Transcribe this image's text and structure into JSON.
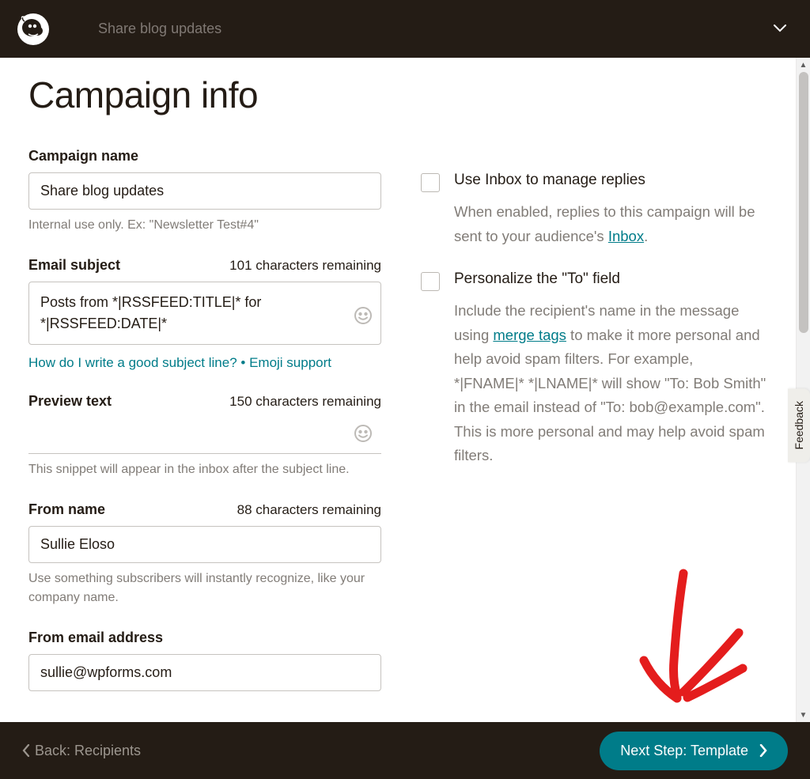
{
  "topbar": {
    "title": "Share blog updates"
  },
  "page": {
    "title": "Campaign info"
  },
  "fields": {
    "campaign_name": {
      "label": "Campaign name",
      "value": "Share blog updates",
      "hint": "Internal use only. Ex: \"Newsletter Test#4\""
    },
    "email_subject": {
      "label": "Email subject",
      "counter": "101 characters remaining",
      "value": "Posts from *|RSSFEED:TITLE|* for *|RSSFEED:DATE|*",
      "help_link1": "How do I write a good subject line?",
      "help_link2": "Emoji support"
    },
    "preview_text": {
      "label": "Preview text",
      "counter": "150 characters remaining",
      "value": "",
      "hint": "This snippet will appear in the inbox after the subject line."
    },
    "from_name": {
      "label": "From name",
      "counter": "88 characters remaining",
      "value": "Sullie Eloso",
      "hint": "Use something subscribers will instantly recognize, like your company name."
    },
    "from_email": {
      "label": "From email address",
      "value": "sullie@wpforms.com"
    }
  },
  "options": {
    "inbox": {
      "title": "Use Inbox to manage replies",
      "desc_before": "When enabled, replies to this campaign will be sent to your audience's ",
      "link": "Inbox",
      "desc_after": "."
    },
    "personalize": {
      "title": "Personalize the \"To\" field",
      "desc_before": "Include the recipient's name in the message using ",
      "link": "merge tags",
      "desc_after": " to make it more personal and help avoid spam filters. For example, *|FNAME|* *|LNAME|* will show \"To: Bob Smith\" in the email instead of \"To: bob@example.com\". This is more personal and may help avoid spam filters."
    }
  },
  "footer": {
    "back": "Back: Recipients",
    "next": "Next Step: Template"
  },
  "feedback": "Feedback"
}
